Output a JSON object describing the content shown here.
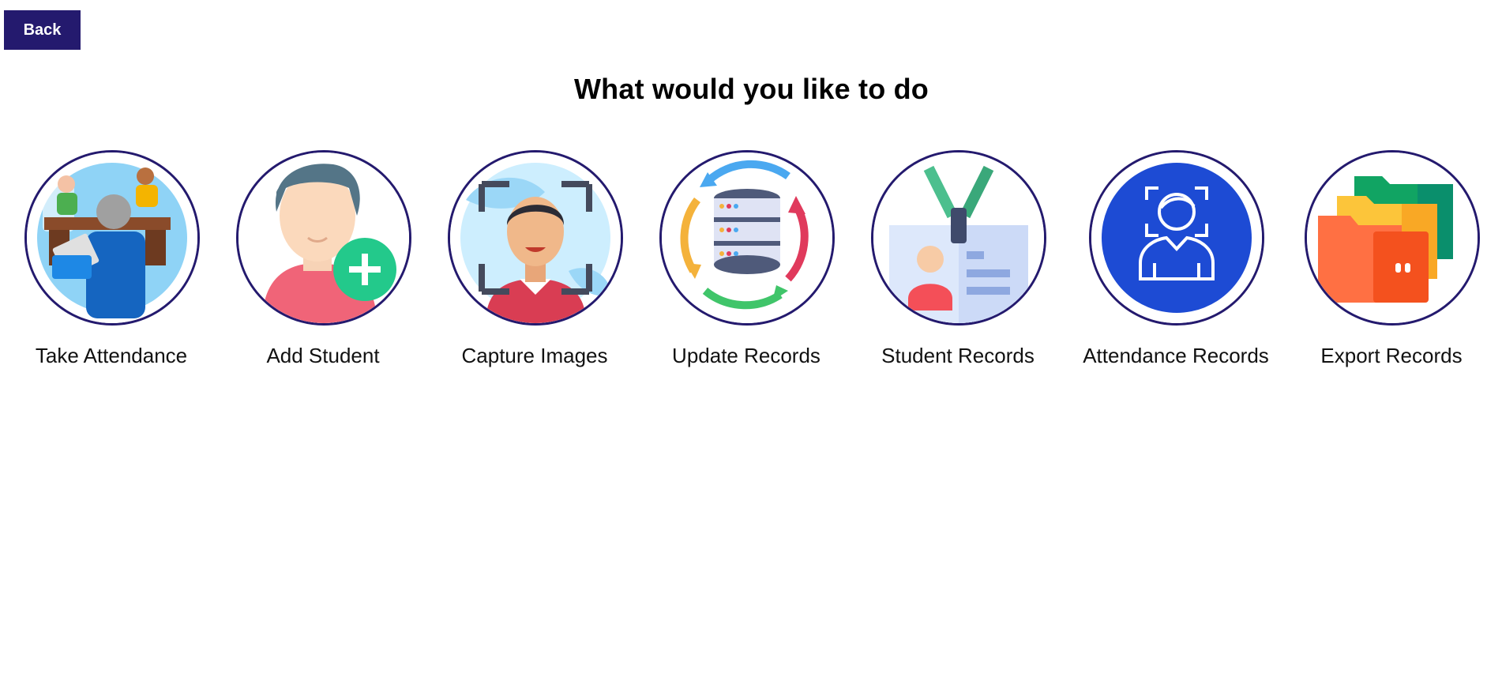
{
  "header": {
    "back_label": "Back",
    "title": "What would you like to do"
  },
  "colors": {
    "accent": "#241a6e",
    "background": "#ffffff"
  },
  "actions": [
    {
      "label": "Take Attendance",
      "icon": "classroom-attendance-icon"
    },
    {
      "label": "Add Student",
      "icon": "add-student-icon"
    },
    {
      "label": "Capture Images",
      "icon": "face-capture-icon"
    },
    {
      "label": "Update Records",
      "icon": "database-sync-icon"
    },
    {
      "label": "Student Records",
      "icon": "id-badge-icon"
    },
    {
      "label": "Attendance Records",
      "icon": "face-scan-user-icon"
    },
    {
      "label": "Export Records",
      "icon": "folders-icon"
    }
  ]
}
